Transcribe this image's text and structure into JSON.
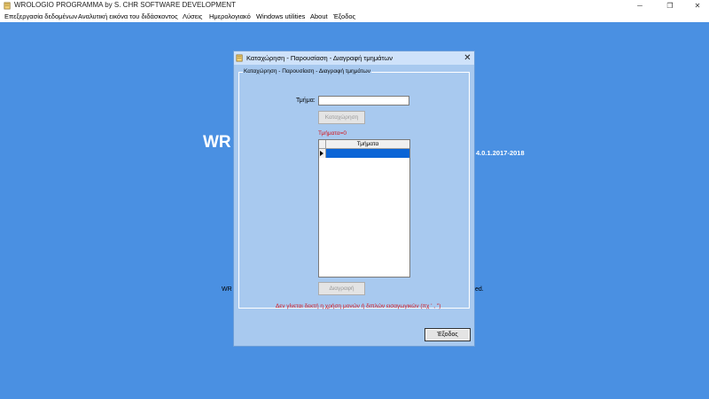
{
  "window": {
    "title": "WROLOGIO PROGRAMMA by S. CHR SOFTWARE DEVELOPMENT",
    "minimize_glyph": "─",
    "restore_glyph": "❐",
    "close_glyph": "✕"
  },
  "menu": [
    {
      "label": "Επεξεργασία δεδομένων"
    },
    {
      "label": "Αναλυτική εικόνα του διδάσκοντος"
    },
    {
      "label": "Λύσεις"
    },
    {
      "label": "Ημερολογιακό"
    },
    {
      "label": "Windows utilities"
    },
    {
      "label": "About"
    },
    {
      "label": "Έξοδος"
    }
  ],
  "background": {
    "title_fragment": "WR",
    "version_fragment": "4.0.1.2017-2018",
    "footer_left_fragment": "WR",
    "footer_right_fragment": "ed."
  },
  "dialog": {
    "title": "Καταχώρηση - Παρουσίαση - Διαγραφή τμημάτων",
    "close_glyph": "✕",
    "group_title": "Καταχώρηση - Παρουσίαση - Διαγραφή τμημάτων",
    "field_label": "Τμήμα:",
    "field_value": "",
    "register_button": "Καταχώρηση",
    "count_text": "Τμήματα=0",
    "grid_header": "Τμήματα",
    "delete_button": "Διαγραφή",
    "warning_text": "Δεν γίνεται δεκτή η χρήση μονών ή διπλών εισαγωγικών (πχ ' , \")",
    "exit_button": "Έξοδος"
  },
  "colors": {
    "desktop_bg": "#4a90e2",
    "dialog_bg": "#a8c9ef",
    "selection": "#0a64d6",
    "warning": "#d4141b"
  }
}
